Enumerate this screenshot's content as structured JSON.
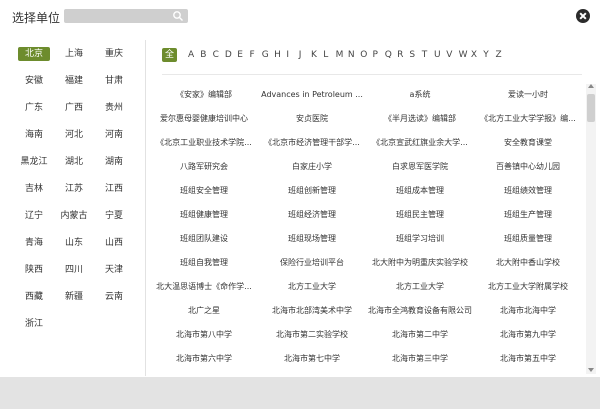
{
  "header": {
    "title": "选择单位",
    "search_placeholder": ""
  },
  "provinces": [
    "北京",
    "上海",
    "重庆",
    "安徽",
    "福建",
    "甘肃",
    "广东",
    "广西",
    "贵州",
    "海南",
    "河北",
    "河南",
    "黑龙江",
    "湖北",
    "湖南",
    "吉林",
    "江苏",
    "江西",
    "辽宁",
    "内蒙古",
    "宁夏",
    "青海",
    "山东",
    "山西",
    "陕西",
    "四川",
    "天津",
    "西藏",
    "新疆",
    "云南",
    "浙江"
  ],
  "active_province": "北京",
  "letters": [
    "全部",
    "A",
    "B",
    "C",
    "D",
    "E",
    "F",
    "G",
    "H",
    "I",
    "J",
    "K",
    "L",
    "M",
    "N",
    "O",
    "P",
    "Q",
    "R",
    "S",
    "T",
    "U",
    "V",
    "W",
    "X",
    "Y",
    "Z"
  ],
  "active_letter": "全部",
  "units": [
    [
      "《安家》编辑部",
      "Advances in Petroleum ...",
      "a系统",
      "爱读一小时"
    ],
    [
      "爱尔惠母婴健康培训中心",
      "安贞医院",
      "《半月选读》编辑部",
      "《北方工业大学学报》编..."
    ],
    [
      "《北京工业职业技术学院...",
      "《北京市经济管理干部学...",
      "《北京宣武红旗业余大学...",
      "安全教育课堂"
    ],
    [
      "八路军研究会",
      "白家庄小学",
      "白求恩军医学院",
      "百善镇中心幼儿园"
    ],
    [
      "班组安全管理",
      "班组创新管理",
      "班组成本管理",
      "班组绩效管理"
    ],
    [
      "班组健康管理",
      "班组经济管理",
      "班组民主管理",
      "班组生产管理"
    ],
    [
      "班组团队建设",
      "班组现场管理",
      "班组学习培训",
      "班组质量管理"
    ],
    [
      "班组自我管理",
      "保险行业培训平台",
      "北大附中为明重庆实验学校",
      "北大附中香山学校"
    ],
    [
      "北大温思语博士《命作学...",
      "北方工业大学",
      "北方工业大学",
      "北方工业大学附属学校"
    ],
    [
      "北广之星",
      "北海市北部湾美术中学",
      "北海市全鸿教育设备有限公司",
      "北海市北海中学"
    ],
    [
      "北海市第八中学",
      "北海市第二实验学校",
      "北海市第二中学",
      "北海市第九中学"
    ],
    [
      "北海市第六中学",
      "北海市第七中学",
      "北海市第三中学",
      "北海市第五中学"
    ]
  ],
  "colors": {
    "accent": "#6d8c2d",
    "footer": "#e3e3e3"
  }
}
